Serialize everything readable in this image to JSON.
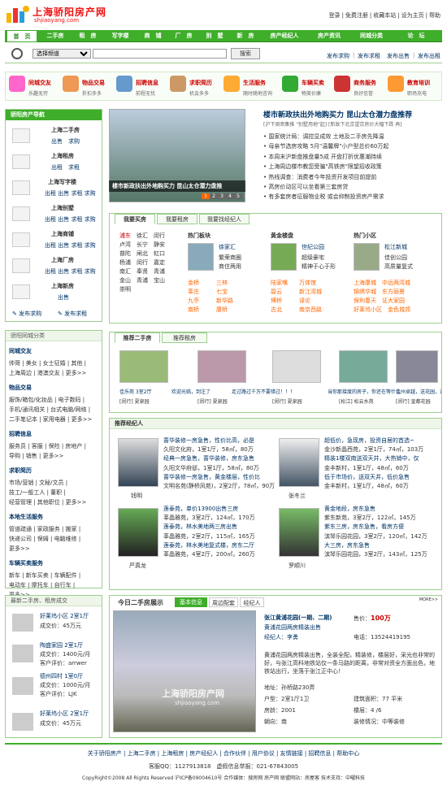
{
  "logo": {
    "name": "上海骄阳房产网",
    "domain": "shjiaoyang.com"
  },
  "toplinks": [
    "登录",
    "|",
    "免费注册",
    "|",
    "收藏本站",
    "|",
    "设为主页",
    "|",
    "帮助"
  ],
  "nav": [
    "首　页",
    "二手房",
    "租　房",
    "写字楼",
    "商　铺",
    "厂　房",
    "别　墅",
    "新　房",
    "房产经纪人",
    "房产资讯",
    "同城分类",
    "论　坛"
  ],
  "search": {
    "select": "选择频道",
    "button": "搜索",
    "links": [
      "发布求购",
      "|",
      "发布求租",
      "发布出售",
      "|",
      "发布出租"
    ]
  },
  "services": [
    {
      "a": "同城交友",
      "b": "乐趣无穷"
    },
    {
      "a": "物品交易",
      "b": "折扣多多"
    },
    {
      "a": "招聘信息",
      "b": "前程无忧"
    },
    {
      "a": "求职简历",
      "b": "机会多多"
    },
    {
      "a": "生活服务",
      "b": "随时随地咨询"
    },
    {
      "a": "车辆买卖",
      "b": "物美价廉"
    },
    {
      "a": "商务服务",
      "b": "良好信誉"
    },
    {
      "a": "教育培训",
      "b": "职场充电"
    }
  ],
  "lnav": {
    "title": "骄阳房产导航",
    "items": [
      {
        "t": "上海二手房",
        "l": "出售　求购"
      },
      {
        "t": "上海租房",
        "l": "出租　求租"
      },
      {
        "t": "上海写字楼",
        "l": "出租 出售 求租 求购"
      },
      {
        "t": "上海别墅",
        "l": "出租 出售 求租 求购"
      },
      {
        "t": "上海商铺",
        "l": "出租 出售 求租 求购"
      },
      {
        "t": "上海厂房",
        "l": "出租 出售 求租 求购"
      },
      {
        "t": "上海新房",
        "l": "出售"
      }
    ],
    "post": [
      "发布求购",
      "发布求租"
    ]
  },
  "cat": {
    "title": "骄阳同城分类",
    "groups": [
      {
        "h": "同城交友",
        "l": [
          "帅哥 | 美女 | 女士征婚 | 其他 |",
          "上海周边 | 港澳交友 | 更多>>"
        ]
      },
      {
        "h": "物品交易",
        "l": [
          "服饰/箱包/化妆品 | 电子数码 |",
          "手机/通讯相关 | 台式电脑/网络 |",
          "二手笔记本 | 家用电器 | 更多>>"
        ]
      },
      {
        "h": "招聘信息",
        "l": [
          "服务员 | 客服 | 保险 | 房地产 |",
          "导购 | 销售 | 更多>>"
        ]
      },
      {
        "h": "求职简历",
        "l": [
          "市场/营销 | 文秘/文员 |",
          "技工/一般工人 | 董职 |",
          "经营管理 | 其他职位 | 更多>>"
        ]
      },
      {
        "h": "本地生活服务",
        "l": [
          "管道疏通 | 家政服务 | 搬家 |",
          "快递公司 | 保姆 | 电脑维修 |",
          "更多>>"
        ]
      },
      {
        "h": "车辆买卖服务",
        "l": [
          "新车 | 新车买卖 | 车辆配件 |",
          "电动车 | 摩托车 | 自行车 |",
          "更多>>"
        ]
      }
    ]
  },
  "recent": {
    "title": "最新二手房、租房成交",
    "items": [
      {
        "a": "好莱坞小区 2室1厅",
        "b": "成交价：45万元"
      },
      {
        "a": "陶盛家园 2室1厅",
        "b": "成交价：1400元/月",
        "c": "客户评价：arrwer"
      },
      {
        "a": "德州四村 1室0厅",
        "b": "成交价：1000元/月",
        "c": "客户评价：LJK"
      },
      {
        "a": "好莱坞小区 2室1厅",
        "b": "成交价：45万元"
      }
    ]
  },
  "feature": {
    "title": "楼市新政扶出外地购买力 昆山太仓潜力盘推荐",
    "sub": "[沪下周密集推 \"别墅用地\"起] [新政下北京望京房价大幅下跌 再]",
    "caption": "楼市新政扶出外地购买力 昆山太仓潜力盘推",
    "pages": [
      "1",
      "2",
      "3",
      "4",
      "5"
    ],
    "news": [
      "国家统计局：调控显成效 土地及二手房先降温",
      "母亲节选房攻略 5月\"温馨牌\"小户型总价60万起",
      "本周末沪新盘推盘量5成 开盘打折优惠潮持续",
      "上海周边楼市教您受骗\"高铁房\"限望招收政策",
      "热线调查：消费者今年投资开发项目前提前",
      "高房价动区可以坐看第三套房贷",
      "有多套房者征服物业税 或会抑制投资房产需求"
    ]
  },
  "buy": {
    "tabs": [
      "我要买房",
      "我要租房",
      "我要找经纪人"
    ],
    "areas": [
      "浦东",
      "徐汇",
      "闵行",
      "卢湾",
      "长宁",
      "静安",
      "普陀",
      "闸北",
      "虹口",
      "杨浦",
      "闵行",
      "嘉定",
      "南汇",
      "奉贤",
      "青浦",
      "金山",
      "青浦",
      "宝山",
      "崇明"
    ],
    "hot": {
      "h": "热门板块",
      "name": "徐家汇",
      "l": [
        "繁荣商圈",
        "商住两用"
      ],
      "list": [
        "金桥",
        "三林",
        "莘庄",
        "七宝",
        "九亭",
        "新华路",
        "南桥",
        "康桥"
      ]
    },
    "gold": {
      "h": "黄金楼盘",
      "name": "世纪公园",
      "l": [
        "超级豪宅",
        "精神于心于形"
      ],
      "list": [
        "陆家嘴",
        "万体馆",
        "碧云",
        "新江湾城",
        "博桥",
        "译论",
        "古北",
        "南京西路"
      ]
    },
    "hotr": {
      "h": "热门小区",
      "name": "松江新城",
      "l": [
        "佳创公园",
        "高质量复式"
      ],
      "list": [
        "上海康城",
        "中远两湾城",
        "锦绣华城",
        "东方丽景",
        "保利春天",
        "证大家园",
        "好莱坞小区",
        "金色城郊"
      ]
    }
  },
  "rec": {
    "tabs": [
      "推荐二手房",
      "推荐租房"
    ],
    "items": [
      {
        "a": "佳乐苑 3室2厅",
        "b": "[闵行] 夏泉园"
      },
      {
        "a": "欢迎光临，到注了",
        "b": "[闵行] 夏泉园"
      },
      {
        "a": "走过路过千万不要错过！！！",
        "b": "[闵行] 夏泉园"
      },
      {
        "a": "当你那接度的房子，你还在等什么",
        "b": "[松江] 松云水苑"
      },
      {
        "a": "佳州卓越，送花园，送车库",
        "b": "[闵行] 皇都花园"
      }
    ]
  },
  "agents": {
    "title": "推荐经纪人",
    "people": [
      {
        "name": "钱明",
        "lines": [
          "蔷华装修一房急售，性价比高，必是",
          "久阳文化府，1室1厅，58㎡，80万",
          "经典一房急售，蔷华装修，房东急售",
          "久阳文华府邸，1室1厅，58㎡，80万",
          "蔷华装修一房急售，黄金楼层，性价比",
          "文明名苑(静桥凤苑)，2室2厅，78㎡，90万"
        ]
      },
      {
        "name": "张冬兰",
        "lines": [
          "超低价，急现房，投资自居的首选~",
          "金沙新晶西苑，2室1厅，74㎡，103万",
          "精装1楼双南送双天井，大热销中，仅",
          "金丰新村，1室1厅，48㎡，60万",
          "低于市场价，送双天井，低价急售",
          "金丰新村，1室1厅，48㎡，60万"
        ]
      },
      {
        "name": "严真龙",
        "lines": [
          "莲泰苑，单价13900出售三房",
          "莘晶雅苑，3室2厅，124㎡，170万",
          "莲泰苑，林水美地两三房出售",
          "莘晶雅苑，2室2厅，115㎡，165万",
          "莲泰苑，林水美地复式楼，房东二厅",
          "莘晶雅苑，4室2厅，200㎡，260万"
        ]
      },
      {
        "name": "罗顺川",
        "lines": [
          "黄金地段，房东急售",
          "紫东新苑，3室2厅，122㎡，145万",
          "紫东三房，房东急售，看房方便",
          "滨琴乐园花园，3室2厅，120㎡，142万",
          "大三房，房东急售",
          "滨琴乐园花园，3室2厅，143㎡，125万"
        ]
      }
    ]
  },
  "show": {
    "title": "今日二手房展示",
    "tabs": [
      "基本信息",
      "周边配套",
      "经纪人"
    ],
    "more": "MORE>>",
    "name": "张江黄浦花园(一期、二期)",
    "type": "黄浦花园两房精装出售",
    "agent": "经纪人：李勇",
    "price_l": "售价：",
    "price": "100万",
    "tel": "电话：13524419195",
    "desc": "黄浦花园两房精装出售，全装全配，精装修，楼层好，采光也非常的好，与张江高科地铁站仅一条马路的距离，非常对资全方面出色，地铁站出行，坐落于张江正中心！",
    "addr": "地址：孙桥路230弄",
    "huxing": "户型：2室1厅1卫",
    "area": "建筑面积：77 平米",
    "year": "房龄：2001",
    "floor": "楼层：4 /6",
    "direction": "朝向：南",
    "decor": "装修情况：中等装修",
    "wm": "上海骄阳房产网",
    "wm2": "shjiaoyang.com"
  },
  "footer": {
    "links": "关于骄阳房产 | 上海二手房 | 上海租房 | 房产经纪人 | 合作伙伴 | 用户协议 | 友情链接 | 招聘信息 | 帮助中心",
    "qq": "客服QQ：1127913818　虚假信息举报：021-67843005",
    "copy": "CopyRight©2008 All Rights Reserved 沪ICP备09004610号 合作媒体：搜房网 房产网 联盟网站：房屋客 技术支持：中曜科技"
  }
}
